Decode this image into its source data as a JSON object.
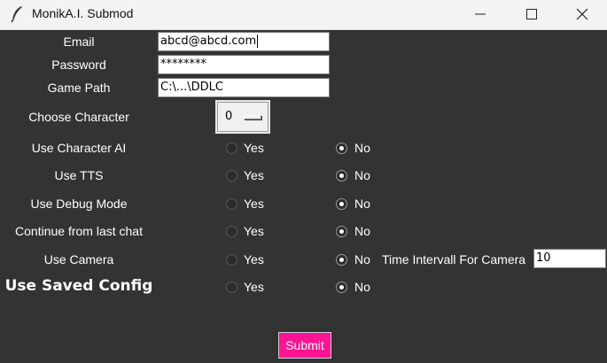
{
  "window": {
    "title": "MonikA.I. Submod",
    "icon": "feather-icon"
  },
  "form": {
    "email_label": "Email",
    "email_value": "abcd@abcd.com",
    "password_label": "Password",
    "password_value": "********",
    "game_path_label": "Game Path",
    "game_path_value": "C:\\...\\DDLC",
    "choose_character_label": "Choose Character",
    "choose_character_value": "0"
  },
  "options": [
    {
      "label": "Use Character AI",
      "selected": "No"
    },
    {
      "label": "Use TTS",
      "selected": "No"
    },
    {
      "label": "Use Debug Mode",
      "selected": "No"
    },
    {
      "label": "Continue from last chat",
      "selected": "No"
    },
    {
      "label": "Use Camera",
      "selected": "No"
    },
    {
      "label": "Use Saved Config",
      "selected": "No"
    }
  ],
  "radio_labels": {
    "yes": "Yes",
    "no": "No"
  },
  "camera": {
    "interval_label": "Time Intervall For Camera",
    "interval_value": "10"
  },
  "submit_label": "Submit",
  "colors": {
    "background": "#333333",
    "submit": "#ff1493",
    "text": "#ffffff"
  }
}
